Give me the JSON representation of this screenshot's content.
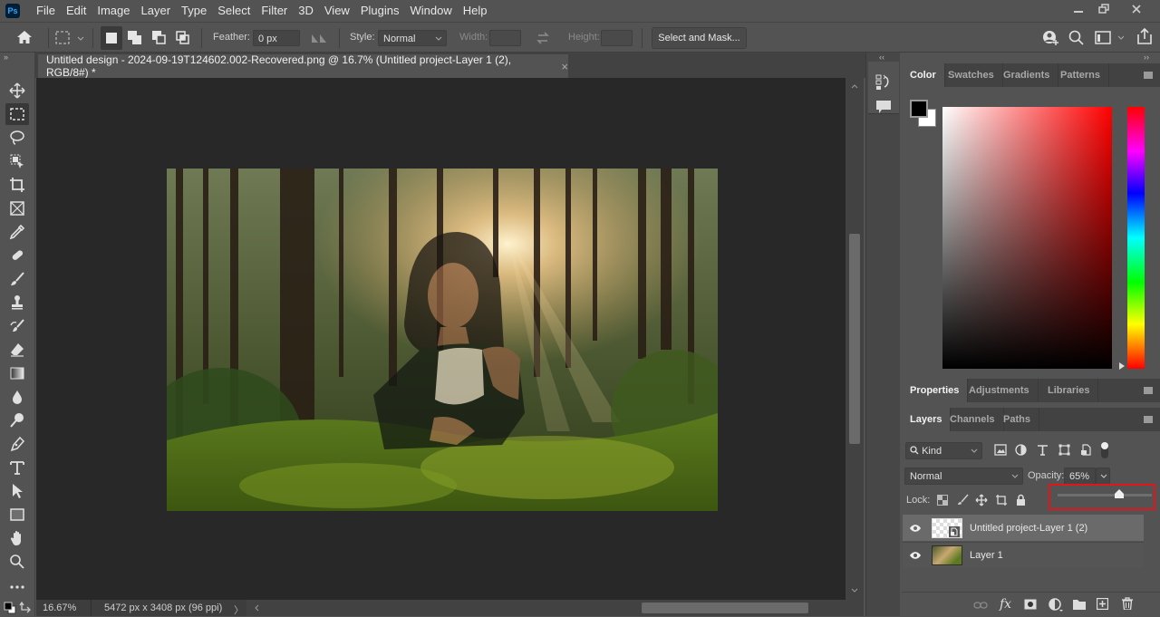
{
  "app": {
    "logo": "Ps",
    "menu": [
      "File",
      "Edit",
      "Image",
      "Layer",
      "Type",
      "Select",
      "Filter",
      "3D",
      "View",
      "Plugins",
      "Window",
      "Help"
    ],
    "window_controls": {
      "minimize": "minimize-icon",
      "restore": "restore-icon",
      "close": "close-icon"
    }
  },
  "options_bar": {
    "feather_label": "Feather:",
    "feather_value": "0 px",
    "style_label": "Style:",
    "style_value": "Normal",
    "width_label": "Width:",
    "width_value": "",
    "height_label": "Height:",
    "height_value": "",
    "select_and_mask": "Select and Mask...",
    "right_icons": [
      "share-user-icon",
      "search-icon",
      "workspace-icon",
      "chevron-down-icon",
      "share-icon"
    ]
  },
  "document": {
    "tab_title": "Untitled design - 2024-09-19T124602.002-Recovered.png @ 16.7% (Untitled project-Layer 1 (2), RGB/8#) *",
    "close_glyph": "×",
    "collapse_glyph": "»"
  },
  "tools": [
    "move-tool",
    "rectangular-marquee-tool",
    "lasso-tool",
    "object-selection-tool",
    "crop-tool",
    "frame-tool",
    "eyedropper-tool",
    "healing-brush-tool",
    "brush-tool",
    "clone-stamp-tool",
    "history-brush-tool",
    "eraser-tool",
    "gradient-tool",
    "blur-tool",
    "dodge-tool",
    "pen-tool",
    "type-tool",
    "path-selection-tool",
    "rectangle-tool",
    "hand-tool",
    "zoom-tool",
    "more-tools"
  ],
  "status_bar": {
    "zoom": "16.67%",
    "doc_info": "5472 px x 3408 px (96 ppi)",
    "arrow": "〉"
  },
  "color_panel": {
    "tabs": [
      "Color",
      "Swatches",
      "Gradients",
      "Patterns"
    ],
    "active_tab": "Color",
    "foreground": "#000000",
    "background": "#ffffff",
    "hue": "#ff0000"
  },
  "properties_panel": {
    "tabs": [
      "Properties",
      "Adjustments",
      "Libraries"
    ],
    "active_tab": "Properties"
  },
  "layers_panel": {
    "tabs": [
      "Layers",
      "Channels",
      "Paths"
    ],
    "active_tab": "Layers",
    "filter_label": "Kind",
    "blend_mode": "Normal",
    "opacity_label": "Opacity:",
    "opacity_value": "65%",
    "opacity_slider_fraction": 0.65,
    "lock_label": "Lock:",
    "layers": [
      {
        "name": "Untitled project-Layer 1 (2)",
        "visible": true,
        "selected": true
      },
      {
        "name": "Layer 1",
        "visible": true,
        "selected": false
      }
    ],
    "footer_icons": [
      "link-icon",
      "fx-icon",
      "mask-icon",
      "adjustment-layer-icon",
      "group-folder-icon",
      "new-layer-icon",
      "trash-icon"
    ],
    "fx_label": "fx"
  },
  "highlight_color": "#e0161a"
}
